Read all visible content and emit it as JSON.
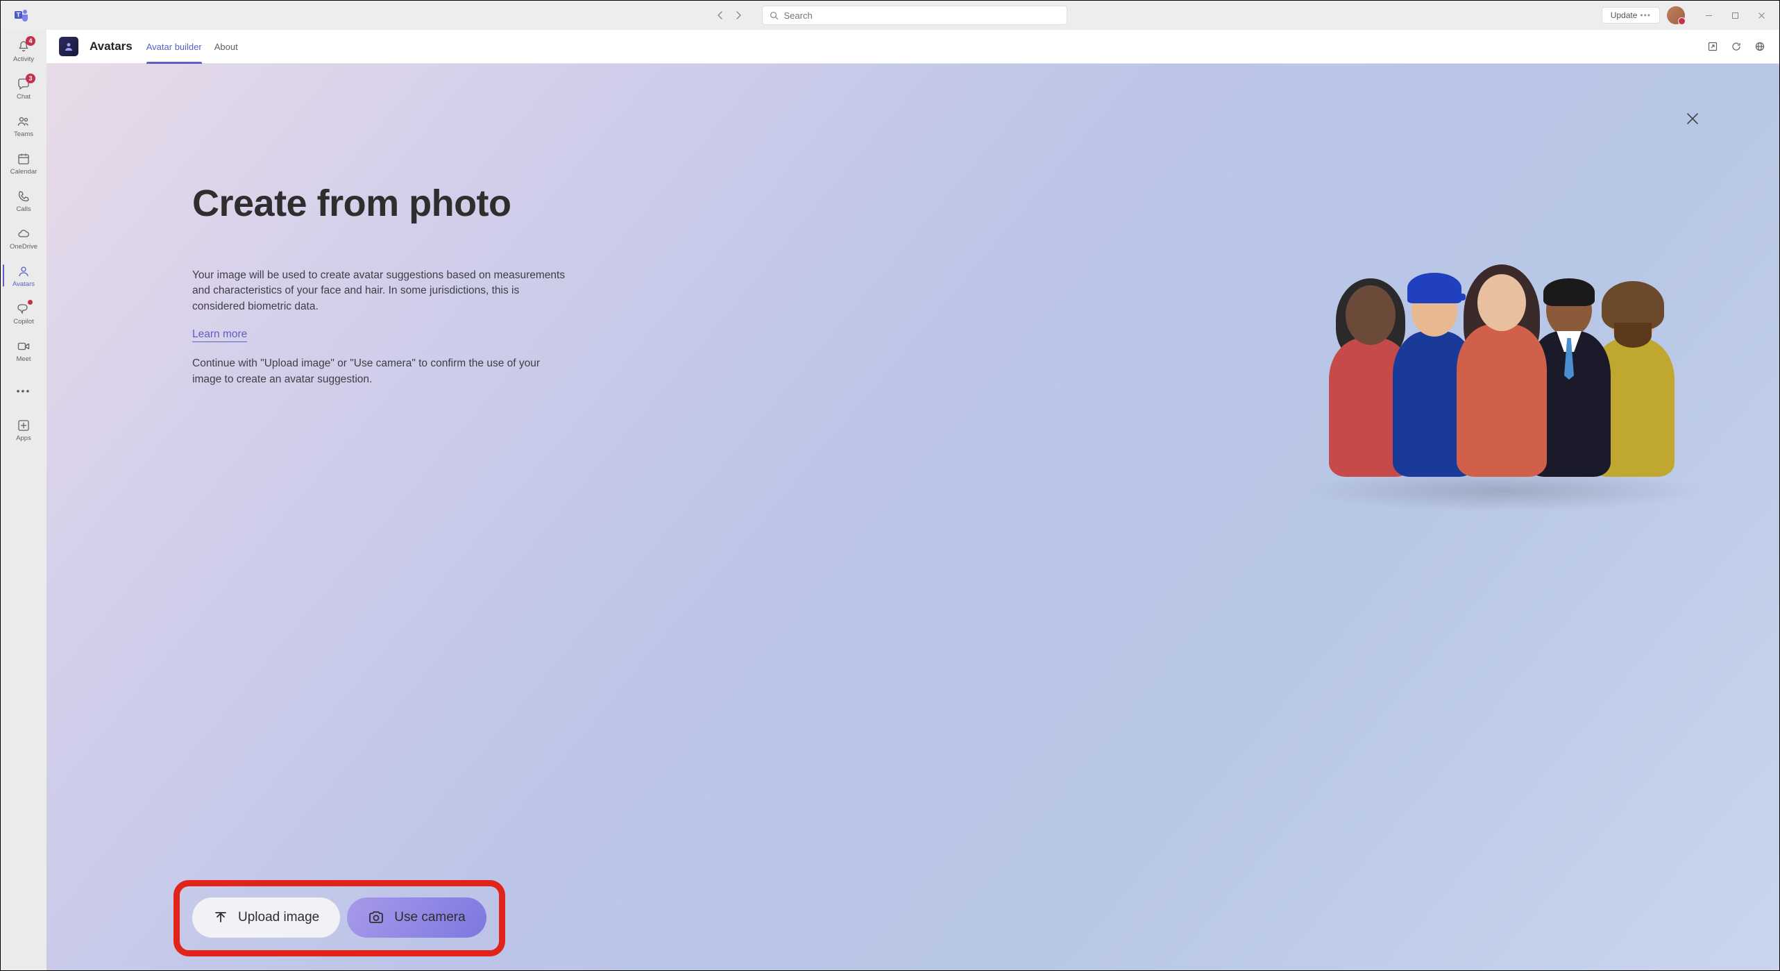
{
  "titlebar": {
    "search_placeholder": "Search",
    "update_label": "Update"
  },
  "rail": {
    "items": [
      {
        "label": "Activity",
        "badge": "4"
      },
      {
        "label": "Chat",
        "badge": "3"
      },
      {
        "label": "Teams"
      },
      {
        "label": "Calendar"
      },
      {
        "label": "Calls"
      },
      {
        "label": "OneDrive"
      },
      {
        "label": "Avatars"
      },
      {
        "label": "Copilot"
      },
      {
        "label": "Meet"
      }
    ],
    "apps_label": "Apps"
  },
  "subheader": {
    "app_title": "Avatars",
    "tabs": [
      {
        "label": "Avatar builder"
      },
      {
        "label": "About"
      }
    ]
  },
  "hero": {
    "title": "Create from photo",
    "paragraph1": "Your image will be used to create avatar suggestions based on measurements and characteristics of your face and hair. In some jurisdictions, this is considered biometric data.",
    "learn_more": "Learn more",
    "paragraph2": "Continue with \"Upload image\" or \"Use camera\" to confirm the use of your image to create an avatar suggestion.",
    "upload_label": "Upload image",
    "camera_label": "Use camera"
  }
}
